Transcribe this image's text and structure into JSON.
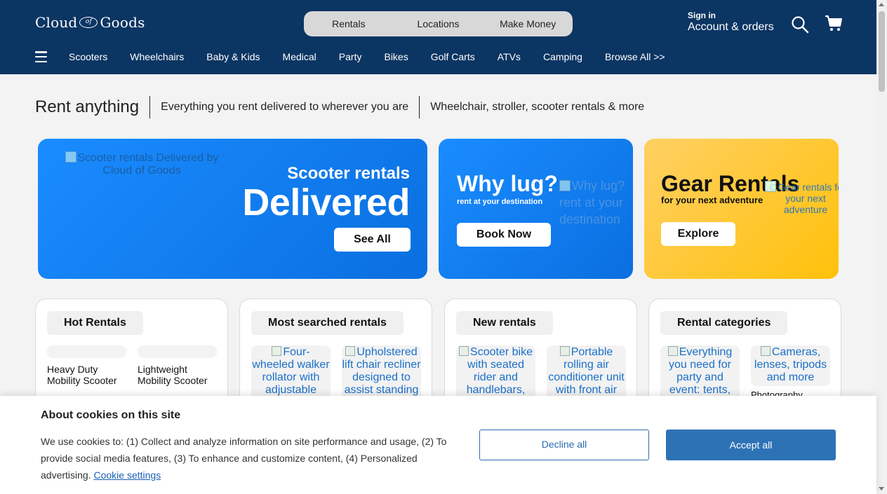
{
  "header": {
    "logo": {
      "part1": "Cloud",
      "part2": "of",
      "part3": "Goods"
    },
    "pill_nav": [
      "Rentals",
      "Locations",
      "Make Money"
    ],
    "signin": {
      "small": "Sign in",
      "big": "Account & orders"
    },
    "icons": {
      "search": "search-icon",
      "cart": "cart-icon",
      "menu": "hamburger-icon"
    }
  },
  "nav": [
    "Scooters",
    "Wheelchairs",
    "Baby & Kids",
    "Medical",
    "Party",
    "Bikes",
    "Golf Carts",
    "ATVs",
    "Camping",
    "Browse All >>"
  ],
  "tagline": {
    "title": "Rent anything",
    "text1": "Everything you rent delivered to wherever you are",
    "text2": "Wheelchair, stroller, scooter rentals & more"
  },
  "promos": {
    "scooter": {
      "img_alt": "Scooter rentals Delivered by Cloud of Goods",
      "subtitle": "Scooter rentals",
      "title": "Delivered",
      "button": "See All"
    },
    "whylug": {
      "title": "Why lug?",
      "subtitle": "rent at your destination",
      "button": "Book Now",
      "img_alt": "Why lug? rent at your destination"
    },
    "gear": {
      "title": "Gear Rentals",
      "subtitle": "for your next adventure",
      "button": "Explore",
      "img_alt": "Gear rentals for your next adventure"
    }
  },
  "cards": {
    "hot": {
      "title": "Hot Rentals",
      "items": [
        "Heavy Duty Mobility Scooter",
        "Lightweight Mobility Scooter"
      ]
    },
    "most_searched": {
      "title": "Most searched rentals",
      "items": [
        "Four-wheeled walker rollator with adjustable",
        "Upholstered lift chair recliner designed to assist standing"
      ]
    },
    "new": {
      "title": "New rentals",
      "items": [
        "Scooter bike with seated rider and handlebars,",
        "Portable rolling air conditioner unit with front air"
      ]
    },
    "categories": {
      "title": "Rental categories",
      "items": [
        "Everything you need for party and event: tents,",
        "Cameras, lenses, tripods and more"
      ],
      "caption": "Photography"
    }
  },
  "cookie": {
    "title": "About cookies on this site",
    "text": "We use cookies to: (1) Collect and analyze information on site performance and usage, (2) To provide social media features, (3) To enhance and customize content, (4) Personalized advertising.",
    "link": "Cookie settings",
    "decline": "Decline all",
    "accept": "Accept all"
  },
  "colors": {
    "header_bg": "#0b3563",
    "promo_blue": "#0a6fe0",
    "promo_yellow": "#ffc10a",
    "accept_btn": "#2e72b6"
  }
}
